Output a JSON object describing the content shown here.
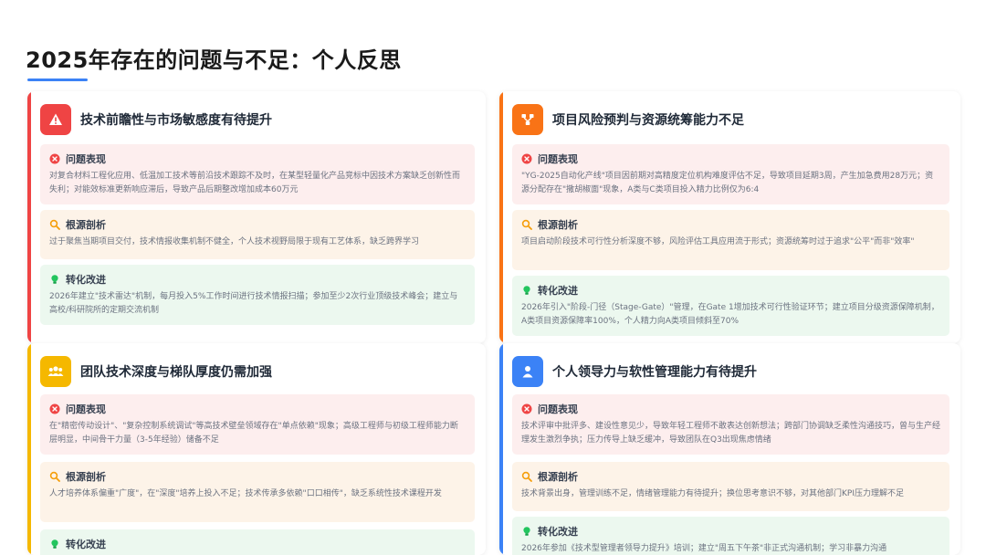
{
  "page": {
    "title": "2025年存在的问题与不足：个人反思"
  },
  "colors": {
    "accent_blue": "#3b82f6",
    "card1_accent": "#ef4444",
    "card2_accent": "#f97316",
    "card3_accent": "#f5b800",
    "card4_accent": "#3b82f6"
  },
  "section_labels": {
    "problem": "问题表现",
    "cause": "根源剖析",
    "improve": "转化改进"
  },
  "cards": [
    {
      "icon": "warning-icon",
      "title": "技术前瞻性与市场敏感度有待提升",
      "problem": "对复合材料工程化应用、低温加工技术等前沿技术跟踪不及时，在某型轻量化产品竞标中因技术方案缺乏创新性而失利；对能效标准更新响应滞后，导致产品后期整改增加成本60万元",
      "cause": "过于聚焦当期项目交付，技术情报收集机制不健全，个人技术视野局限于现有工艺体系，缺乏跨界学习",
      "improve": "2026年建立\"技术雷达\"机制，每月投入5%工作时间进行技术情报扫描；参加至少2次行业顶级技术峰会；建立与高校/科研院所的定期交流机制"
    },
    {
      "icon": "network-icon",
      "title": "项目风险预判与资源统筹能力不足",
      "problem": "\"YG-2025自动化产线\"项目因前期对高精度定位机构难度评估不足，导致项目延期3周，产生加急费用28万元；资源分配存在\"撒胡椒面\"现象，A类与C类项目投入精力比例仅为6:4",
      "cause": "项目启动阶段技术可行性分析深度不够，风险评估工具应用流于形式；资源统筹时过于追求\"公平\"而非\"效率\"",
      "improve": "2026年引入\"阶段-门径（Stage-Gate）\"管理，在Gate 1增加技术可行性验证环节；建立项目分级资源保障机制，A类项目资源保障率100%，个人精力向A类项目倾斜至70%"
    },
    {
      "icon": "team-icon",
      "title": "团队技术深度与梯队厚度仍需加强",
      "problem": "在\"精密传动设计\"、\"复杂控制系统调试\"等高技术壁垒领域存在\"单点依赖\"现象；高级工程师与初级工程师能力断层明显，中间骨干力量（3-5年经验）储备不足",
      "cause": "人才培养体系偏重\"广度\"，在\"深度\"培养上投入不足；技术传承多依赖\"口口相传\"，缺乏系统性技术课程开发",
      "improve": ""
    },
    {
      "icon": "person-icon",
      "title": "个人领导力与软性管理能力有待提升",
      "problem": "技术评审中批评多、建设性意见少，导致年轻工程师不敢表达创新想法；跨部门协调缺乏柔性沟通技巧，曾与生产经理发生激烈争执；压力传导上缺乏缓冲，导致团队在Q3出现焦虑情绪",
      "cause": "技术背景出身，管理训练不足，情绪管理能力有待提升；换位思考意识不够，对其他部门KPI压力理解不足",
      "improve": "2026年参加《技术型管理者领导力提升》培训；建立\"周五下午茶\"非正式沟通机制；学习非暴力沟通"
    }
  ]
}
